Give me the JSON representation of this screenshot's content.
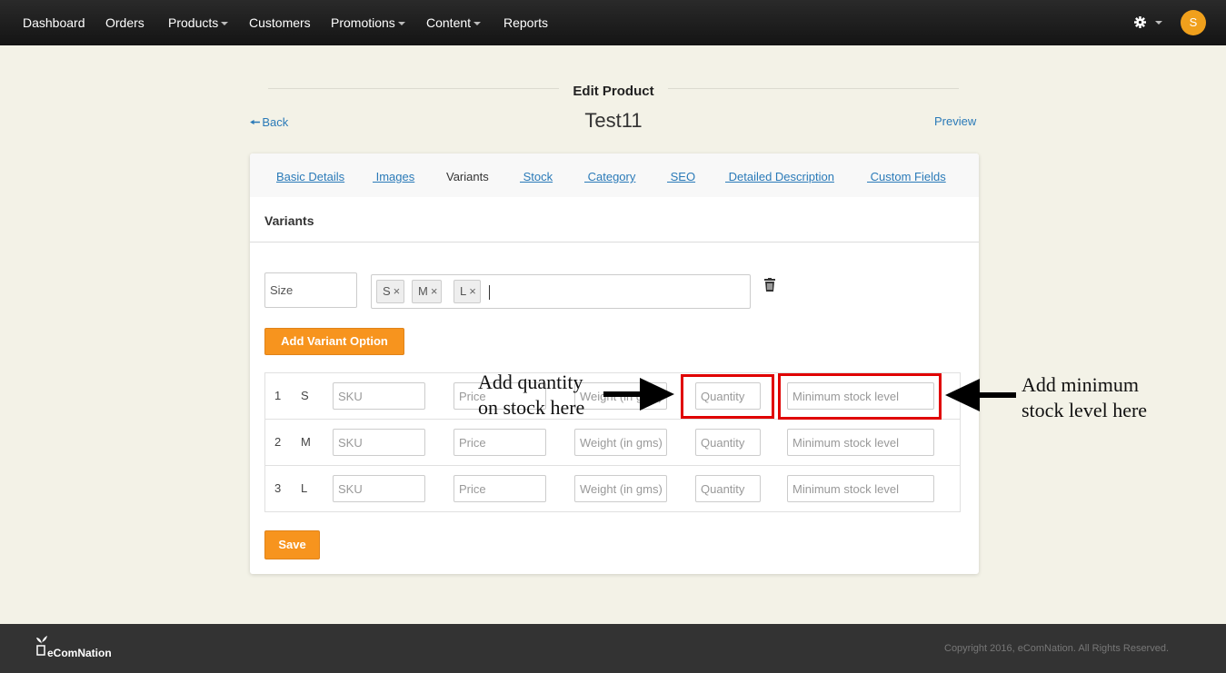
{
  "nav": {
    "items": [
      {
        "label": "Dashboard",
        "dropdown": false
      },
      {
        "label": "Orders",
        "dropdown": false
      },
      {
        "label": "Products",
        "dropdown": true
      },
      {
        "label": "Customers",
        "dropdown": false
      },
      {
        "label": "Promotions",
        "dropdown": true
      },
      {
        "label": "Content",
        "dropdown": true
      },
      {
        "label": "Reports",
        "dropdown": false
      }
    ],
    "settings_icon": "gear-icon",
    "avatar_initial": "S",
    "avatar_color": "#f0a01c"
  },
  "header": {
    "section_title": "Edit Product",
    "back_label": "Back",
    "product_name": "Test11",
    "preview_label": "Preview"
  },
  "tabs": [
    {
      "label": "Basic Details",
      "active": false
    },
    {
      "label": " Images",
      "active": false
    },
    {
      "label": "Variants",
      "active": true
    },
    {
      "label": " Stock",
      "active": false
    },
    {
      "label": " Category",
      "active": false
    },
    {
      "label": " SEO",
      "active": false
    },
    {
      "label": " Detailed Description",
      "active": false
    },
    {
      "label": " Custom Fields",
      "active": false
    }
  ],
  "variants": {
    "title": "Variants",
    "option_name_value": "Size",
    "option_values": [
      "S",
      "M",
      "L"
    ],
    "tag_remove_glyph": "×",
    "add_option_label": "Add Variant Option",
    "placeholders": {
      "sku": "SKU",
      "price": "Price",
      "weight": "Weight (in gms)",
      "quantity": "Quantity",
      "min_stock": "Minimum stock level"
    },
    "rows": [
      {
        "index": "1",
        "value": "S"
      },
      {
        "index": "2",
        "value": "M"
      },
      {
        "index": "3",
        "value": "L"
      }
    ],
    "save_label": "Save"
  },
  "annotations": {
    "quantity_note_line1": "Add quantity",
    "quantity_note_line2": "on stock here",
    "min_stock_note_line1": "Add minimum",
    "min_stock_note_line2": "stock level here",
    "highlight_color": "#e00000"
  },
  "footer": {
    "logo_text": "eComNation",
    "copyright": "Copyright 2016, eComNation. All Rights Reserved."
  },
  "colors": {
    "accent_orange": "#f7941e",
    "link_blue": "#2a7ab8",
    "page_background": "#f3f2e7"
  }
}
